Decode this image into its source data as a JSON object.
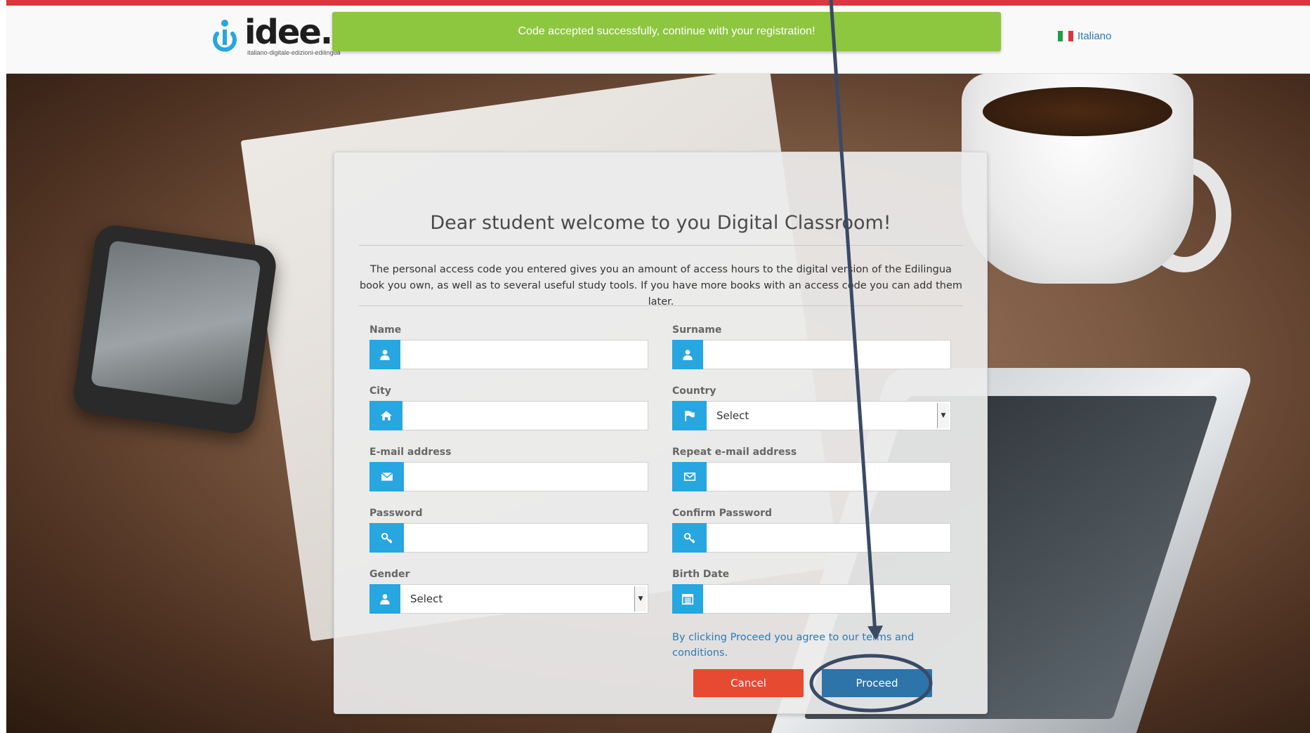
{
  "header": {
    "logo_text": "idee.",
    "logo_tagline": "italiano-digitale-edizioni-edilingua",
    "toast": "Code accepted successfully, continue with your registration!",
    "language": "Italiano"
  },
  "form": {
    "title": "Dear student welcome to you Digital Classroom!",
    "intro": "The personal access code you entered gives you an amount of access hours to the digital version of the Edilingua book you own, as well as to several useful study tools. If you have more books with an access code you can add them later.",
    "fields": {
      "name": {
        "label": "Name",
        "value": ""
      },
      "surname": {
        "label": "Surname",
        "value": ""
      },
      "city": {
        "label": "City",
        "value": ""
      },
      "country": {
        "label": "Country",
        "value": "Select"
      },
      "email": {
        "label": "E-mail address",
        "value": ""
      },
      "email_repeat": {
        "label": "Repeat e-mail address",
        "value": ""
      },
      "password": {
        "label": "Password",
        "value": ""
      },
      "password_confirm": {
        "label": "Confirm Password",
        "value": ""
      },
      "gender": {
        "label": "Gender",
        "value": "Select"
      },
      "birth_date": {
        "label": "Birth Date",
        "value": ""
      }
    },
    "terms": "By clicking Proceed you agree to our terms and conditions.",
    "cancel_label": "Cancel",
    "proceed_label": "Proceed"
  },
  "colors": {
    "accent_blue": "#27a6e0",
    "toast_green": "#8dc63f",
    "cancel_red": "#e64a31",
    "proceed_blue": "#2d74a8",
    "annotation_navy": "#3a4a66"
  }
}
